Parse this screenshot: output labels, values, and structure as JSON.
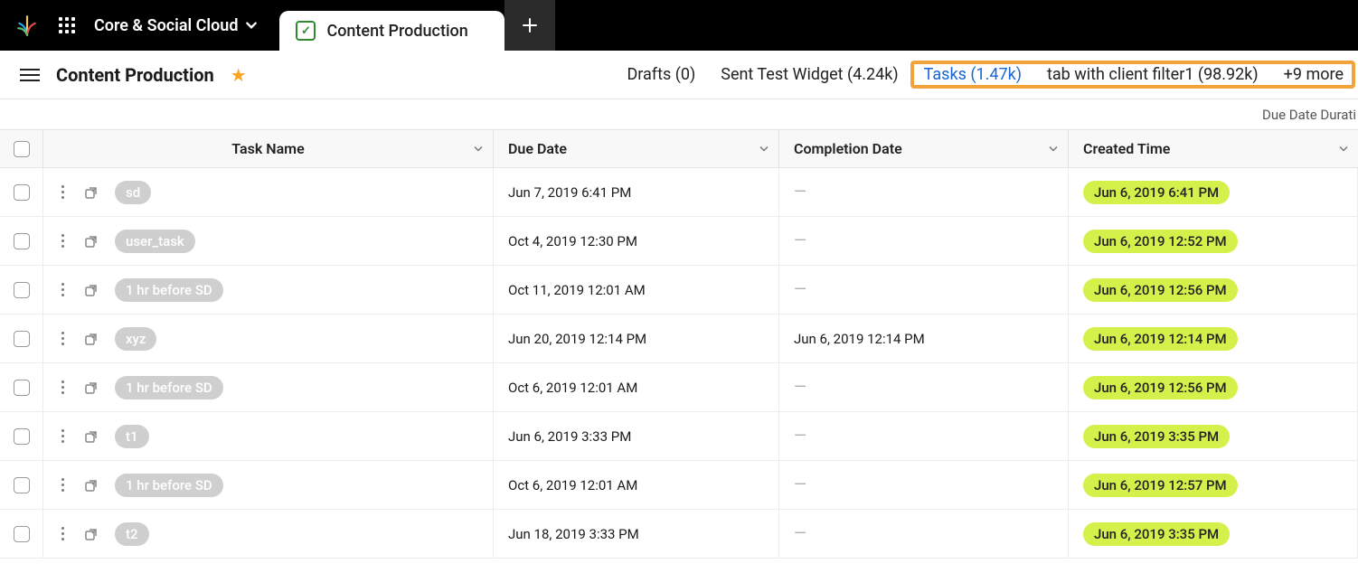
{
  "topnav": {
    "workspace_label": "Core & Social Cloud",
    "active_tab_label": "Content Production"
  },
  "page": {
    "title": "Content Production",
    "starred": true,
    "hint_right": "Due Date Durati"
  },
  "subtabs": {
    "items": [
      {
        "label": "Drafts (0)",
        "active": false
      },
      {
        "label": "Sent Test Widget (4.24k)",
        "active": false
      },
      {
        "label": "Tasks (1.47k)",
        "active": true
      },
      {
        "label": "tab with client filter1 (98.92k)",
        "active": false
      },
      {
        "label": "+9 more",
        "active": false
      }
    ]
  },
  "columns": {
    "task": "Task Name",
    "due": "Due Date",
    "comp": "Completion Date",
    "created": "Created Time"
  },
  "rows": [
    {
      "name": "sd",
      "due": "Jun 7, 2019 6:41 PM",
      "comp": "",
      "created": "Jun 6, 2019 6:41 PM"
    },
    {
      "name": "user_task",
      "due": "Oct 4, 2019 12:30 PM",
      "comp": "",
      "created": "Jun 6, 2019 12:52 PM"
    },
    {
      "name": "1 hr before SD",
      "due": "Oct 11, 2019 12:01 AM",
      "comp": "",
      "created": "Jun 6, 2019 12:56 PM"
    },
    {
      "name": "xyz",
      "due": "Jun 20, 2019 12:14 PM",
      "comp": "Jun 6, 2019 12:14 PM",
      "created": "Jun 6, 2019 12:14 PM"
    },
    {
      "name": "1 hr before SD",
      "due": "Oct 6, 2019 12:01 AM",
      "comp": "",
      "created": "Jun 6, 2019 12:56 PM"
    },
    {
      "name": "t1",
      "due": "Jun 6, 2019 3:33 PM",
      "comp": "",
      "created": "Jun 6, 2019 3:35 PM"
    },
    {
      "name": "1 hr before SD",
      "due": "Oct 6, 2019 12:01 AM",
      "comp": "",
      "created": "Jun 6, 2019 12:57 PM"
    },
    {
      "name": "t2",
      "due": "Jun 18, 2019 3:33 PM",
      "comp": "",
      "created": "Jun 6, 2019 3:35 PM"
    }
  ]
}
